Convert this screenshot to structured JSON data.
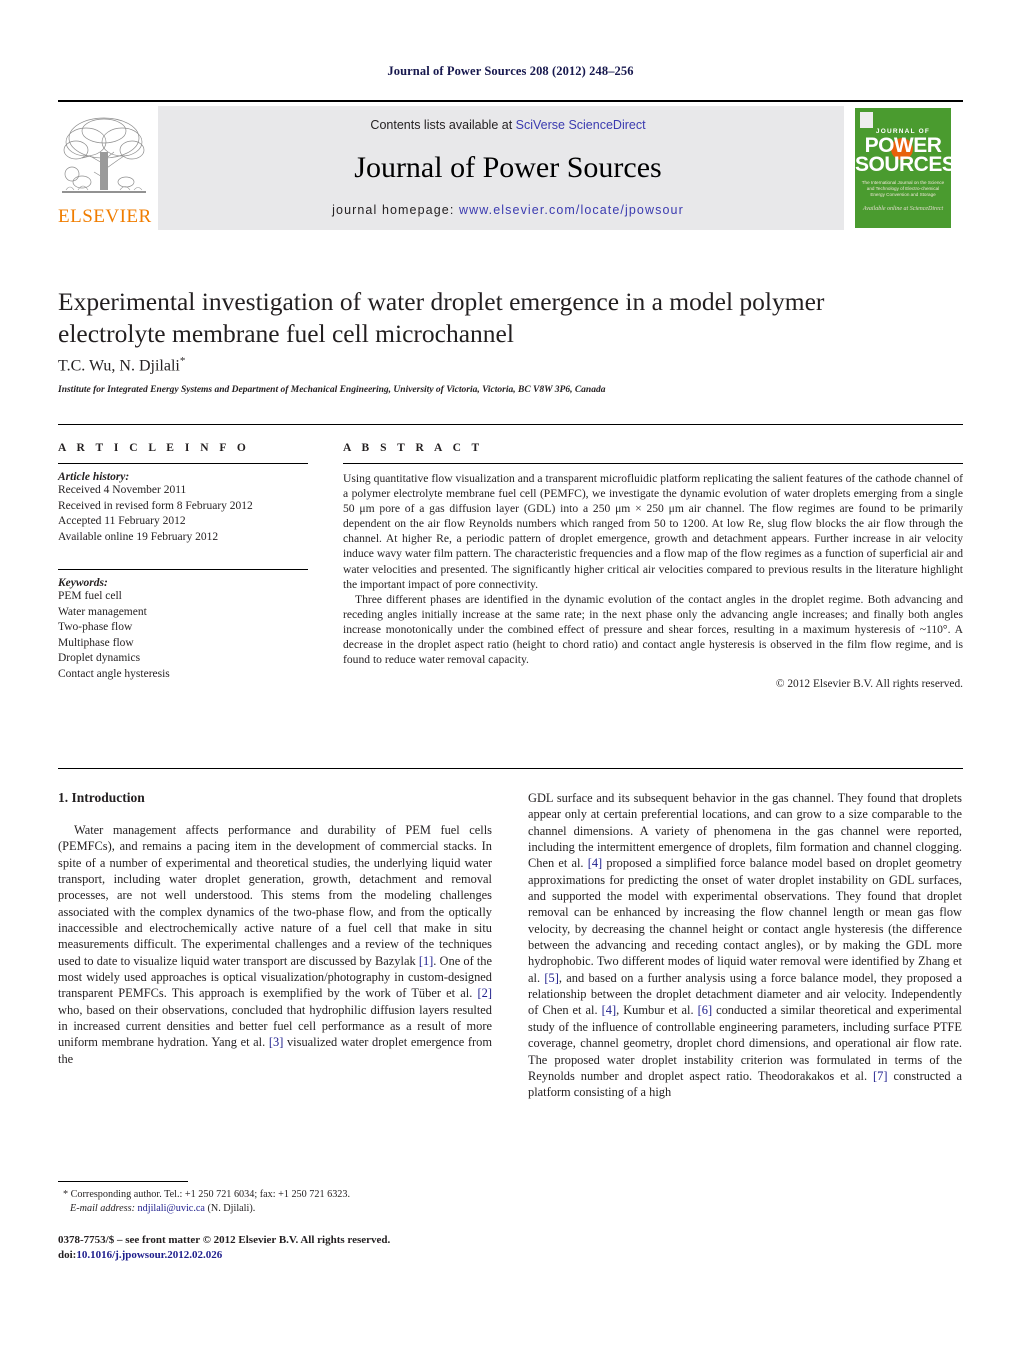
{
  "running_head": "Journal of Power Sources 208 (2012) 248–256",
  "masthead": {
    "publisher_name": "ELSEVIER",
    "contents_prefix": "Contents lists available at ",
    "contents_link": "SciVerse ScienceDirect",
    "journal_title": "Journal of Power Sources",
    "homepage_prefix": "journal homepage: ",
    "homepage_link": "www.elsevier.com/locate/jpowsour",
    "cover": {
      "line_top": "JOURNAL OF",
      "line_big": "POWER SOURCES",
      "subtitle": "The International Journal on the Science and Technology of Electro-chemical Energy Conversion and Storage",
      "footer": "Available online at ScienceDirect"
    }
  },
  "article": {
    "title": "Experimental investigation of water droplet emergence in a model polymer electrolyte membrane fuel cell microchannel",
    "authors": "T.C. Wu, N. Djilali",
    "author_marker": "*",
    "affiliation": "Institute for Integrated Energy Systems and Department of Mechanical Engineering, University of Victoria, Victoria, BC V8W 3P6, Canada"
  },
  "article_info": {
    "heading": "A R T I C L E  I N F O",
    "history_label": "Article history:",
    "history": [
      "Received 4 November 2011",
      "Received in revised form 8 February 2012",
      "Accepted 11 February 2012",
      "Available online 19 February 2012"
    ],
    "keywords_label": "Keywords:",
    "keywords": [
      "PEM fuel cell",
      "Water management",
      "Two-phase flow",
      "Multiphase flow",
      "Droplet dynamics",
      "Contact angle hysteresis"
    ]
  },
  "abstract": {
    "heading": "A B S T R A C T",
    "paragraphs": [
      "Using quantitative flow visualization and a transparent microfluidic platform replicating the salient features of the cathode channel of a polymer electrolyte membrane fuel cell (PEMFC), we investigate the dynamic evolution of water droplets emerging from a single 50 μm pore of a gas diffusion layer (GDL) into a 250 μm × 250 μm air channel. The flow regimes are found to be primarily dependent on the air flow Reynolds numbers which ranged from 50 to 1200. At low Re, slug flow blocks the air flow through the channel. At higher Re, a periodic pattern of droplet emergence, growth and detachment appears. Further increase in air velocity induce wavy water film pattern. The characteristic frequencies and a flow map of the flow regimes as a function of superficial air and water velocities and presented. The significantly higher critical air velocities compared to previous results in the literature highlight the important impact of pore connectivity.",
      "Three different phases are identified in the dynamic evolution of the contact angles in the droplet regime. Both advancing and receding angles initially increase at the same rate; in the next phase only the advancing angle increases; and finally both angles increase monotonically under the combined effect of pressure and shear forces, resulting in a maximum hysteresis of ~110°. A decrease in the droplet aspect ratio (height to chord ratio) and contact angle hysteresis is observed in the film flow regime, and is found to reduce water removal capacity."
    ],
    "copyright": "© 2012 Elsevier B.V. All rights reserved."
  },
  "body": {
    "section_number_title": "1.  Introduction",
    "left_paragraph": "Water management affects performance and durability of PEM fuel cells (PEMFCs), and remains a pacing item in the development of commercial stacks. In spite of a number of experimental and theoretical studies, the underlying liquid water transport, including water droplet generation, growth, detachment and removal processes, are not well understood. This stems from the modeling challenges associated with the complex dynamics of the two-phase flow, and from the optically inaccessible and electrochemically active nature of a fuel cell that make in situ measurements difficult. The experimental challenges and a review of the techniques used to date to visualize liquid water transport are discussed by Bazylak [1]. One of the most widely used approaches is optical visualization/photography in custom-designed transparent PEMFCs. This approach is exemplified by the work of Tüber et al. [2] who, based on their observations, concluded that hydrophilic diffusion layers resulted in increased current densities and better fuel cell performance as a result of more uniform membrane hydration. Yang et al. [3] visualized water droplet emergence from the",
    "right_paragraph": "GDL surface and its subsequent behavior in the gas channel. They found that droplets appear only at certain preferential locations, and can grow to a size comparable to the channel dimensions. A variety of phenomena in the gas channel were reported, including the intermittent emergence of droplets, film formation and channel clogging. Chen et al. [4] proposed a simplified force balance model based on droplet geometry approximations for predicting the onset of water droplet instability on GDL surfaces, and supported the model with experimental observations. They found that droplet removal can be enhanced by increasing the flow channel length or mean gas flow velocity, by decreasing the channel height or contact angle hysteresis (the difference between the advancing and receding contact angles), or by making the GDL more hydrophobic. Two different modes of liquid water removal were identified by Zhang et al. [5], and based on a further analysis using a force balance model, they proposed a relationship between the droplet detachment diameter and air velocity. Independently of Chen et al. [4], Kumbur et al. [6] conducted a similar theoretical and experimental study of the influence of controllable engineering parameters, including surface PTFE coverage, channel geometry, droplet chord dimensions, and operational air flow rate. The proposed water droplet instability criterion was formulated in terms of the Reynolds number and droplet aspect ratio. Theodorakakos et al. [7] constructed a platform consisting of a high"
  },
  "footnotes": {
    "corresponding_marker": "*",
    "corresponding_text": "Corresponding author. Tel.: +1 250 721 6034; fax: +1 250 721 6323.",
    "email_label": "E-mail address:",
    "email": "ndjilali@uvic.ca",
    "email_owner": "(N. Djilali).",
    "issn_line": "0378-7753/$ – see front matter © 2012 Elsevier B.V. All rights reserved.",
    "doi_label": "doi:",
    "doi": "10.1016/j.jpowsour.2012.02.026"
  },
  "colors": {
    "running_head": "#17184e",
    "link_blue": "#3b3bb0",
    "citation_blue": "#1d1d8c",
    "elsevier_orange": "#f07d00",
    "cover_green": "#4a9b2f",
    "banner_gray": "#e8e8ea"
  }
}
